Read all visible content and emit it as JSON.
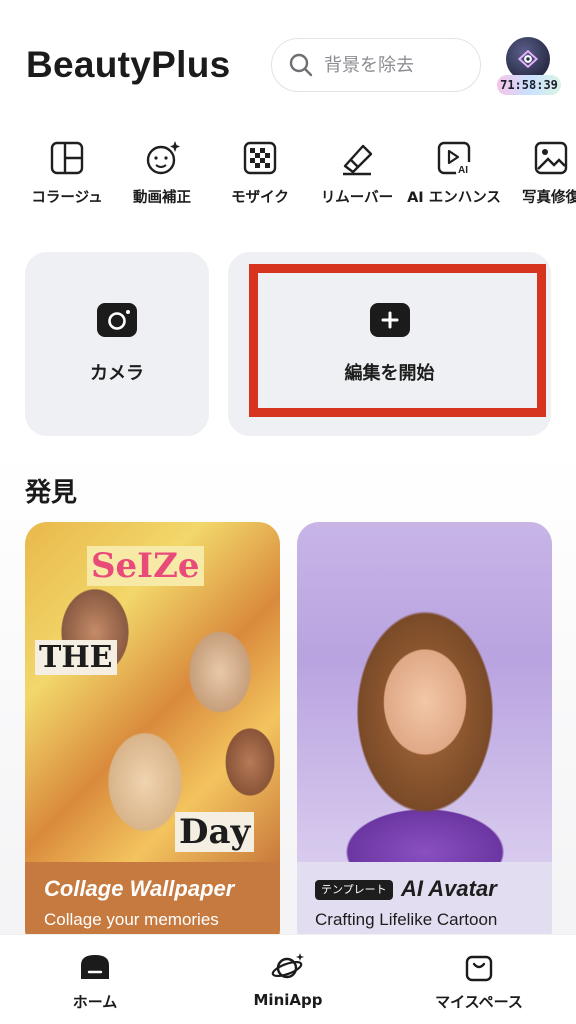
{
  "header": {
    "app_title": "BeautyPlus",
    "search_placeholder": "背景を除去",
    "vip_timer": "71:58:39"
  },
  "tools": [
    {
      "label": "コラージュ",
      "icon": "collage-icon"
    },
    {
      "label": "動画補正",
      "icon": "face-sparkle-icon"
    },
    {
      "label": "モザイク",
      "icon": "mosaic-icon"
    },
    {
      "label": "リムーバー",
      "icon": "eraser-icon"
    },
    {
      "label": "AI エンハンス",
      "icon": "ai-enhance-icon"
    },
    {
      "label": "写真修復",
      "icon": "photo-restore-icon"
    }
  ],
  "actions": {
    "camera_label": "カメラ",
    "edit_label": "編集を開始"
  },
  "discover": {
    "title": "発見",
    "cards": [
      {
        "title": "Collage Wallpaper",
        "subtitle": "Collage your memories",
        "tag": ""
      },
      {
        "title": "AI Avatar",
        "subtitle": "Crafting Lifelike Cartoon",
        "tag": "テンプレート"
      }
    ]
  },
  "collage_words": [
    "SeIZe",
    "THE",
    "Day"
  ],
  "bottom_nav": [
    {
      "label": "ホーム",
      "icon": "home-icon"
    },
    {
      "label": "MiniApp",
      "icon": "planet-icon"
    },
    {
      "label": "マイスペース",
      "icon": "bag-icon"
    }
  ],
  "colors": {
    "accent_highlight": "#d6341f",
    "card_bg": "#eff0f3",
    "collage_footer": "#c77a3f",
    "avatar_footer": "#e3ddf1"
  }
}
